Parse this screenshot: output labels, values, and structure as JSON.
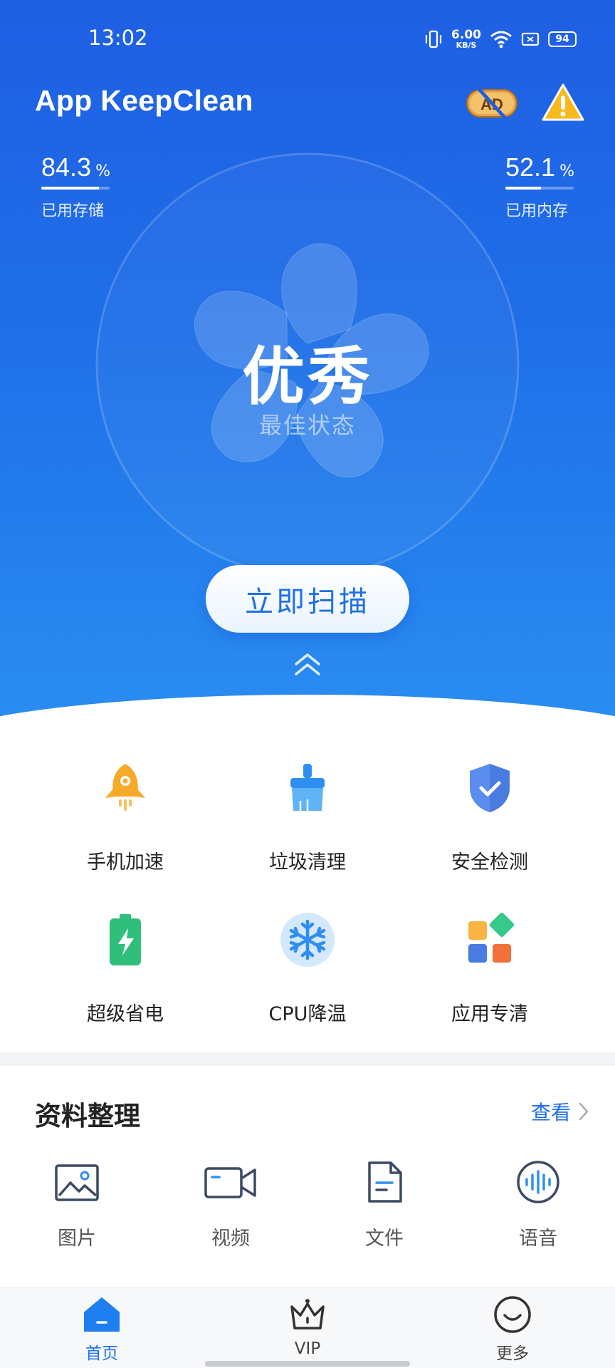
{
  "status_bar": {
    "time": "13:02",
    "net_speed_value": "6.00",
    "net_speed_unit": "KB/S",
    "battery": "94"
  },
  "header": {
    "title": "App KeepClean",
    "ad_icon": "ad-off-icon",
    "warning_icon": "warning-icon"
  },
  "stats": {
    "storage": {
      "value": "84.3",
      "unit": "%",
      "label": "已用存储",
      "fraction": 0.843
    },
    "memory": {
      "value": "52.1",
      "unit": "%",
      "label": "已用内存",
      "fraction": 0.521
    }
  },
  "gauge": {
    "grade": "优秀",
    "subtitle": "最佳状态"
  },
  "scan_button": {
    "label": "立即扫描"
  },
  "features": [
    {
      "label": "手机加速",
      "icon": "rocket-icon"
    },
    {
      "label": "垃圾清理",
      "icon": "broom-icon"
    },
    {
      "label": "安全检测",
      "icon": "shield-check-icon"
    },
    {
      "label": "超级省电",
      "icon": "battery-bolt-icon"
    },
    {
      "label": "CPU降温",
      "icon": "snowflake-icon"
    },
    {
      "label": "应用专清",
      "icon": "apps-grid-icon"
    }
  ],
  "files_section": {
    "title": "资料整理",
    "view_label": "查看",
    "items": [
      {
        "label": "图片",
        "icon": "image-icon"
      },
      {
        "label": "视频",
        "icon": "video-icon"
      },
      {
        "label": "文件",
        "icon": "document-icon"
      },
      {
        "label": "语音",
        "icon": "audio-icon"
      }
    ]
  },
  "bottom_nav": [
    {
      "label": "首页",
      "icon": "home-icon",
      "active": true
    },
    {
      "label": "VIP",
      "icon": "crown-icon",
      "active": false
    },
    {
      "label": "更多",
      "icon": "smiley-icon",
      "active": false
    }
  ],
  "colors": {
    "primary": "#1f6fe8",
    "hero_top": "#1f5fe3",
    "hero_bottom": "#2a8ef1",
    "accent_orange": "#f7a92a",
    "green": "#2fbf7a"
  }
}
